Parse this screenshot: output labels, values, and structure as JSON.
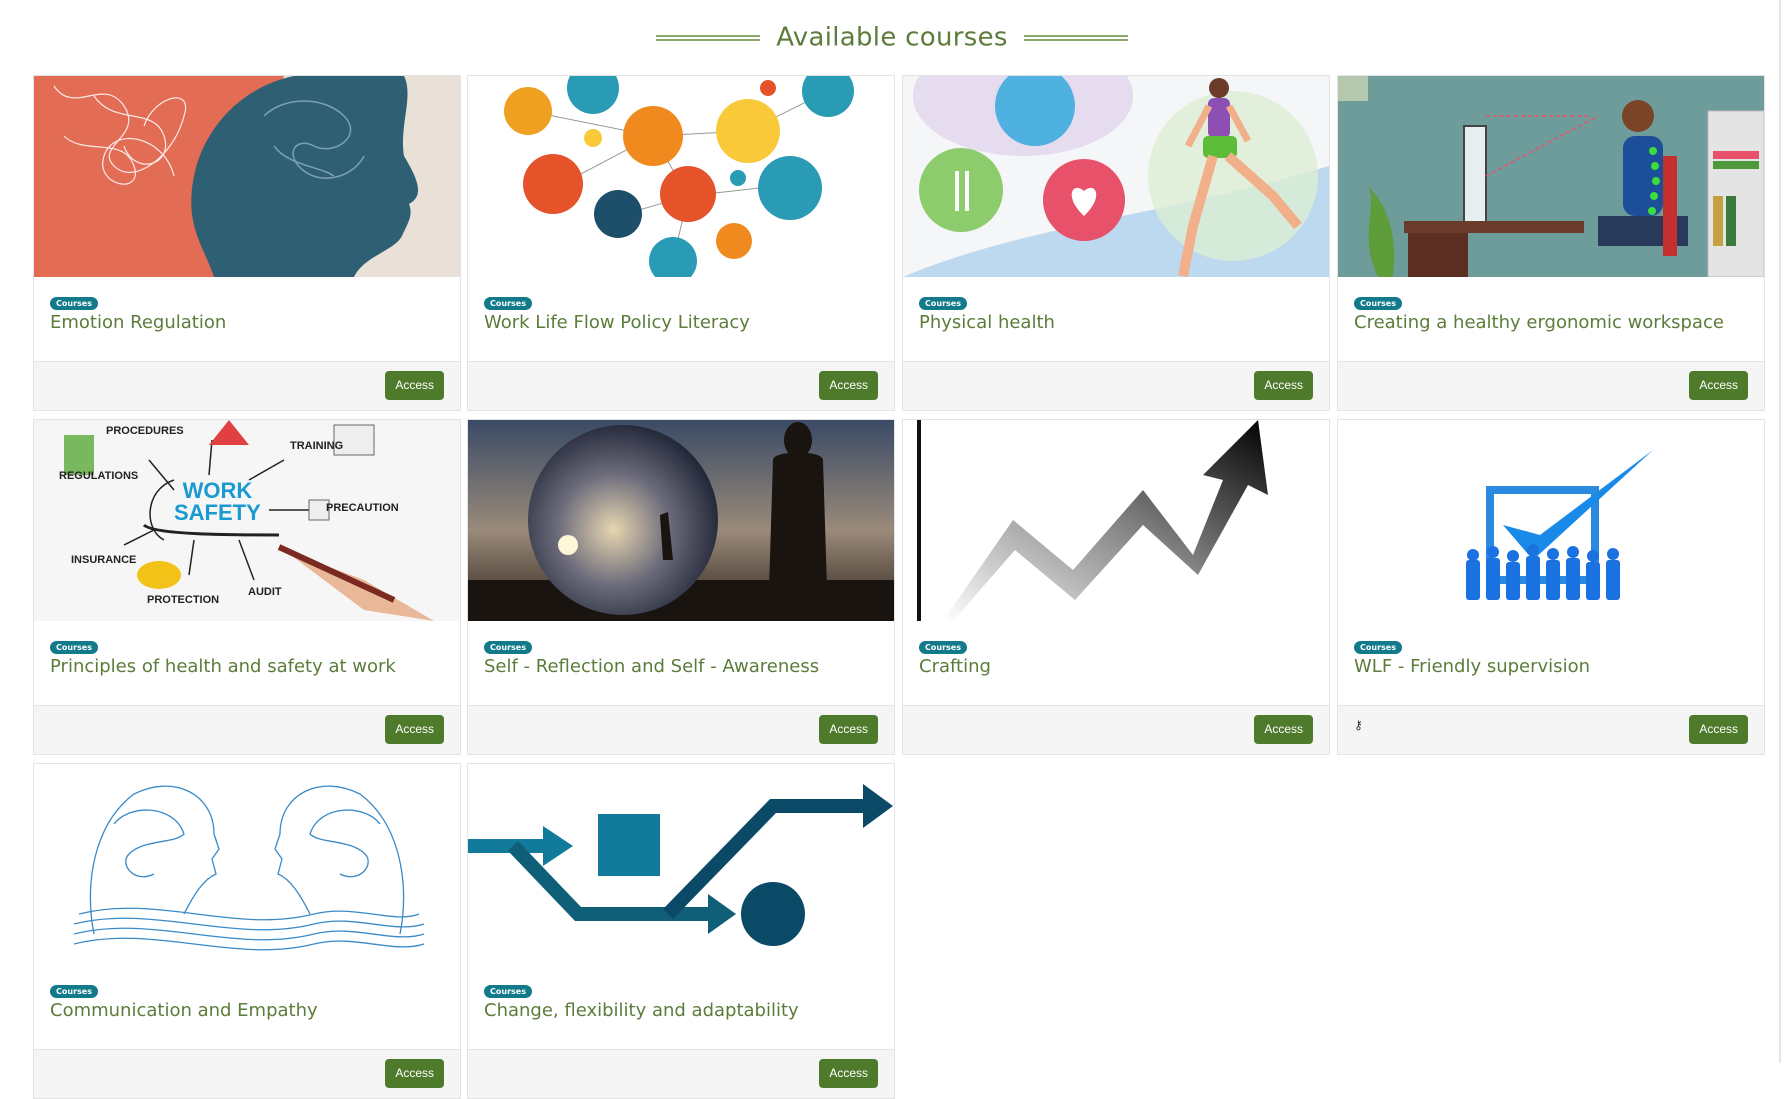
{
  "page": {
    "heading": "Available courses"
  },
  "courses": [
    {
      "badge": "Courses",
      "title": "Emotion Regulation",
      "action": "Access",
      "image": "brain-profile-illustration"
    },
    {
      "badge": "Courses",
      "title": "Work Life Flow Policy Literacy",
      "action": "Access",
      "image": "network-icons-illustration"
    },
    {
      "badge": "Courses",
      "title": "Physical health",
      "action": "Access",
      "image": "runner-health-illustration"
    },
    {
      "badge": "Courses",
      "title": "Creating a healthy ergonomic workspace",
      "action": "Access",
      "image": "ergonomic-desk-illustration"
    },
    {
      "badge": "Courses",
      "title": "Principles of health and safety at work",
      "action": "Access",
      "image": "work-safety-diagram"
    },
    {
      "badge": "Courses",
      "title": "Self - Reflection and Self - Awareness",
      "action": "Access",
      "image": "crystal-ball-photo"
    },
    {
      "badge": "Courses",
      "title": "Crafting",
      "action": "Access",
      "image": "rising-arrow-graphic"
    },
    {
      "badge": "Courses",
      "title": "WLF - Friendly supervision",
      "action": "Access",
      "image": "team-checkmark-graphic",
      "footer_icon": "key-icon"
    },
    {
      "badge": "Courses",
      "title": "Communication and Empathy",
      "action": "Access",
      "image": "two-heads-brains-sketch"
    },
    {
      "badge": "Courses",
      "title": "Change, flexibility and adaptability",
      "action": "Access",
      "image": "process-arrows-graphic"
    }
  ],
  "colors": {
    "title_green": "#5b7c3a",
    "button_green": "#4e7a2c",
    "badge_teal": "#127a8a",
    "footer_bg": "#f5f5f5"
  }
}
